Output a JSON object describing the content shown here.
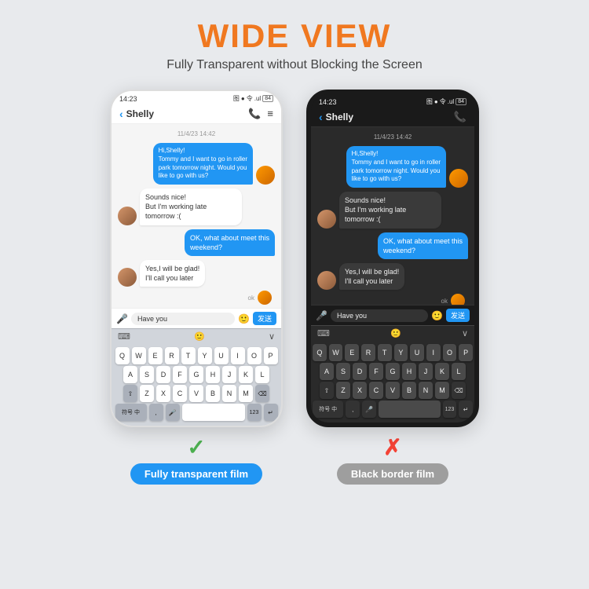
{
  "header": {
    "title": "WIDE VIEW",
    "subtitle": "Fully Transparent without Blocking the Screen"
  },
  "phones": [
    {
      "id": "phone-left",
      "frame": "white",
      "status_time": "14:23",
      "status_icons": "图 ● 令 .ul 84",
      "contact_name": "Shelly",
      "date_label": "11/4/23 14:42",
      "messages": [
        {
          "type": "sent",
          "text": "Hi,Shelly!\nTommy and I want to go in roller\npark tomorrow night. Would you\nlike to go with us?",
          "has_food_avatar": true
        },
        {
          "type": "received",
          "text": "Sounds nice!\nBut I'm working late tomorrow :("
        },
        {
          "type": "sent",
          "text": "OK, what about meet this\nweekend?"
        },
        {
          "type": "received",
          "text": "Yes,I will be glad!\nI'll call you later"
        }
      ],
      "input_text": "Have you",
      "send_label": "发送",
      "keyboard_rows": [
        [
          "Q",
          "W",
          "E",
          "R",
          "T",
          "Y",
          "U",
          "I",
          "O",
          "P"
        ],
        [
          "A",
          "S",
          "D",
          "F",
          "G",
          "H",
          "J",
          "K",
          "L"
        ],
        [
          "Z",
          "X",
          "C",
          "V",
          "B",
          "N",
          "M"
        ]
      ],
      "bottom_symbol": "✓",
      "bottom_label": "Fully transparent film",
      "bottom_label_color": "blue"
    },
    {
      "id": "phone-right",
      "frame": "dark",
      "status_time": "14:23",
      "status_icons": "图 ● 令 .ul 84",
      "contact_name": "Shelly",
      "date_label": "11/4/23 14:42",
      "messages": [
        {
          "type": "sent",
          "text": "Hi,Shelly!\nTommy and I want to go in roller\npark tomorrow night. Would you\nlike to go with us?",
          "has_food_avatar": true
        },
        {
          "type": "received",
          "text": "Sounds nice!\nBut I'm working late tomorrow :("
        },
        {
          "type": "sent",
          "text": "OK, what about meet this\nweekend?"
        },
        {
          "type": "received",
          "text": "Yes,I will be glad!\nI'll call you later"
        }
      ],
      "input_text": "Have you",
      "send_label": "发送",
      "keyboard_rows": [
        [
          "Q",
          "W",
          "E",
          "R",
          "T",
          "Y",
          "U",
          "I",
          "O",
          "P"
        ],
        [
          "A",
          "S",
          "D",
          "F",
          "G",
          "H",
          "J",
          "K",
          "L"
        ],
        [
          "Z",
          "X",
          "C",
          "V",
          "B",
          "N",
          "M"
        ]
      ],
      "bottom_symbol": "✗",
      "bottom_label": "Black border film",
      "bottom_label_color": "gray"
    }
  ]
}
